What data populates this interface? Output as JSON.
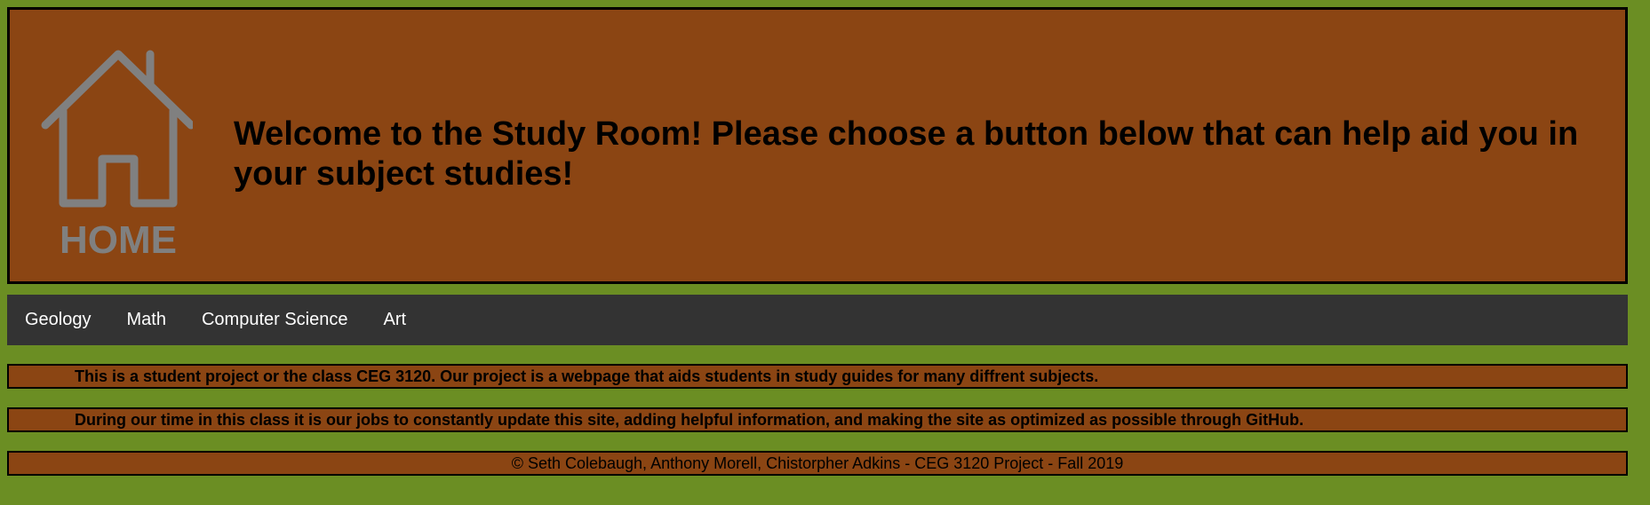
{
  "header": {
    "logo_icon": "home-icon",
    "logo_text": "HOME",
    "title": "Welcome to the Study Room! Please choose a button below that can help aid you in your subject studies!"
  },
  "nav": {
    "items": [
      {
        "label": "Geology"
      },
      {
        "label": "Math"
      },
      {
        "label": "Computer Science"
      },
      {
        "label": "Art"
      }
    ]
  },
  "info": {
    "line1": "This is a student project or the class CEG 3120. Our project is a webpage that aids students in study guides for many diffrent subjects.",
    "line2": "During our time in this class it is our jobs to constantly update this site, adding helpful information, and making the site as optimized as possible through GitHub."
  },
  "footer": {
    "text": "© Seth Colebaugh, Anthony Morell, Chistorpher Adkins - CEG 3120 Project - Fall 2019"
  },
  "colors": {
    "page_background": "#6b8e23",
    "box_background": "#8b4513",
    "nav_background": "#333333",
    "nav_text": "#ffffff",
    "logo": "#808080"
  }
}
